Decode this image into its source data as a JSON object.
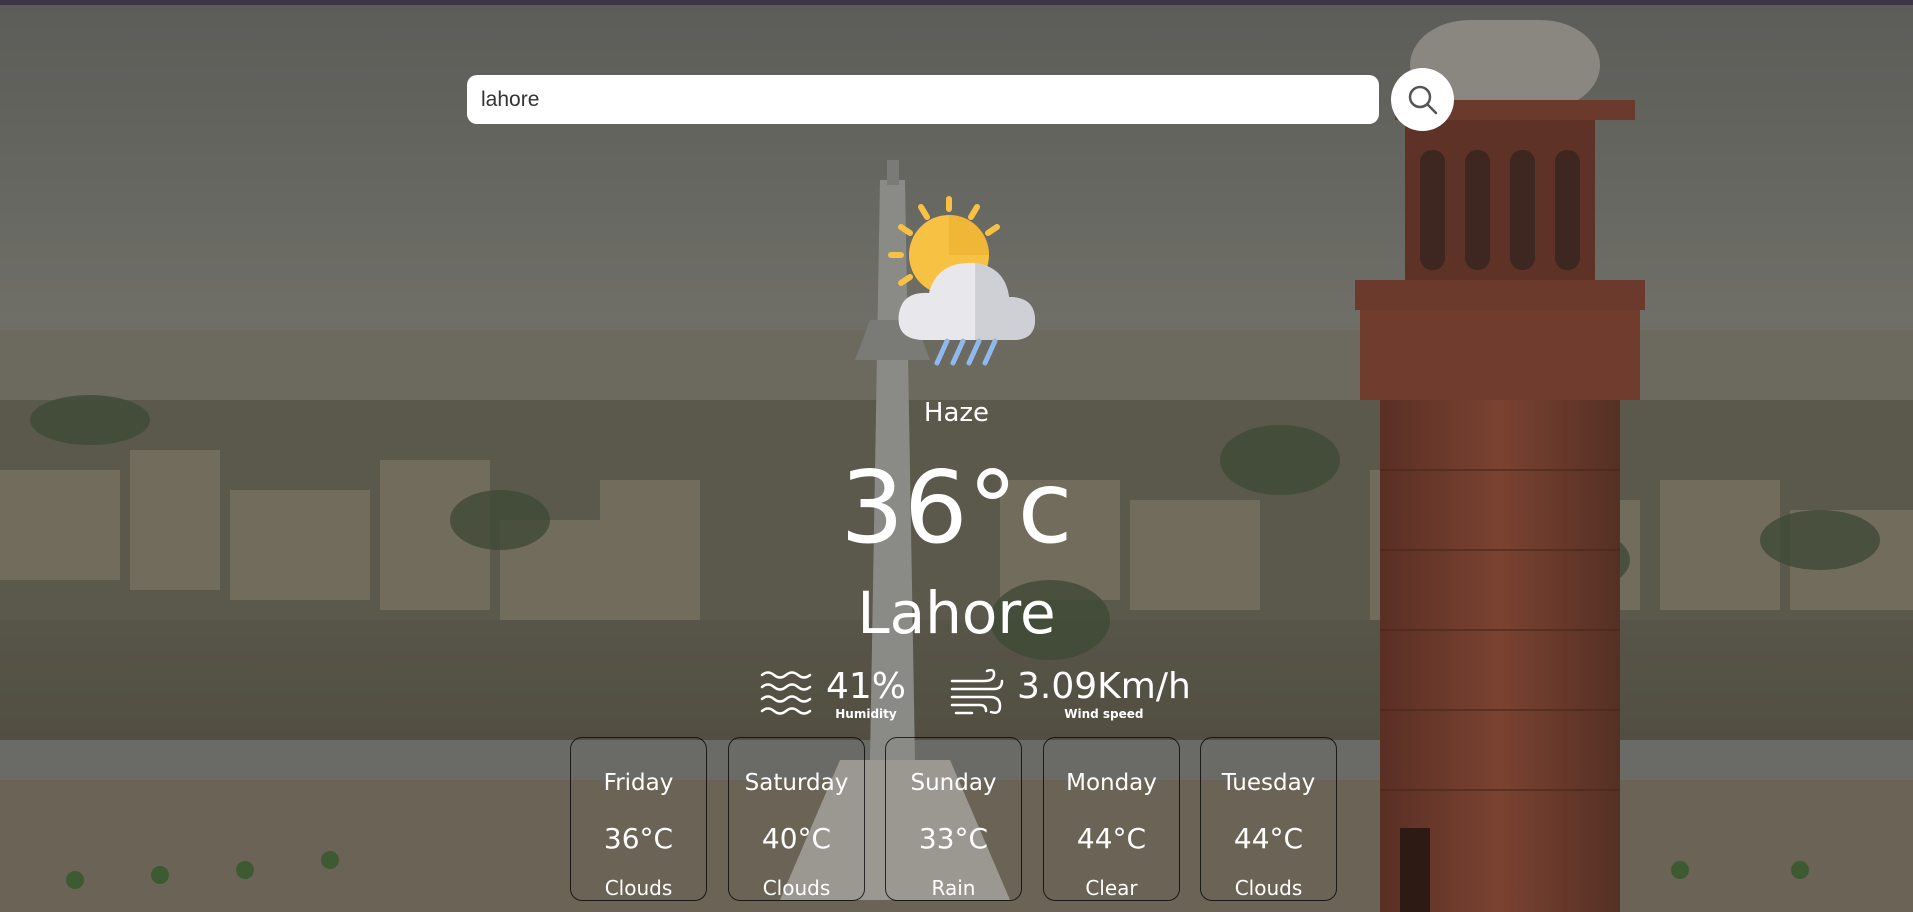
{
  "search": {
    "value": "lahore",
    "button_icon": "search-icon"
  },
  "current": {
    "icon": "sun-cloud-rain-icon",
    "condition": "Haze",
    "temperature": "36°c",
    "city": "Lahore"
  },
  "details": {
    "humidity": {
      "icon": "humidity-waves-icon",
      "value": "41%",
      "label": "Humidity"
    },
    "wind": {
      "icon": "wind-icon",
      "value": "3.09Km/h",
      "label": "Wind speed"
    }
  },
  "forecast": [
    {
      "day": "Friday",
      "temp": "36°C",
      "condition": "Clouds"
    },
    {
      "day": "Saturday",
      "temp": "40°C",
      "condition": "Clouds"
    },
    {
      "day": "Sunday",
      "temp": "33°C",
      "condition": "Rain"
    },
    {
      "day": "Monday",
      "temp": "44°C",
      "condition": "Clear"
    },
    {
      "day": "Tuesday",
      "temp": "44°C",
      "condition": "Clouds"
    }
  ],
  "colors": {
    "sun": "#f7c244",
    "cloud": "#e8e8ec",
    "rain": "#8fb8ef",
    "tower": "#6e3a2c"
  }
}
